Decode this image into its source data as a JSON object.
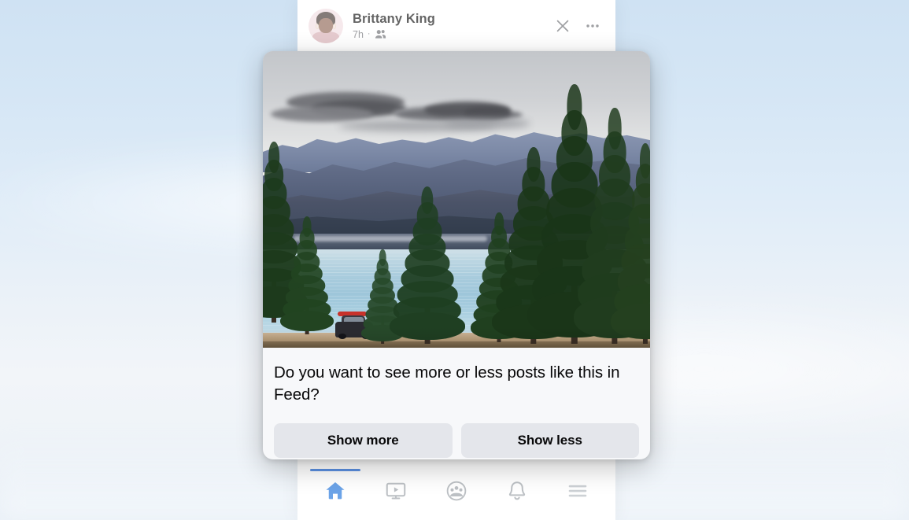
{
  "app": {
    "surface_bg": "#ffffff",
    "backdrop_desc": "blurred-photo-sky"
  },
  "post_header": {
    "avatar": "user-avatar",
    "author_name": "Brittany King",
    "timestamp": "7h",
    "separator": "·",
    "audience_icon": "friends-icon",
    "close_icon": "close-icon",
    "more_icon": "more-options-icon"
  },
  "post_photo": {
    "alt": "Mountain lake with pine trees and a car carrying a red kayak",
    "accent_kayak": "#c8322b",
    "accent_lake": "#9ec6da"
  },
  "dialog": {
    "question": "Do you want to see more or less posts like this in Feed?",
    "buttons": [
      {
        "label": "Show more",
        "name": "show-more-button"
      },
      {
        "label": "Show less",
        "name": "show-less-button"
      }
    ],
    "button_bg": "#e4e6eb",
    "card_bg": "#f7f8fa"
  },
  "bottom_nav": {
    "active_color": "#1b74e4",
    "inactive_color": "#bcc0c4",
    "items": [
      {
        "name": "nav-home",
        "icon": "home-icon",
        "active": true
      },
      {
        "name": "nav-watch",
        "icon": "video-icon",
        "active": false
      },
      {
        "name": "nav-groups",
        "icon": "groups-icon",
        "active": false
      },
      {
        "name": "nav-notifications",
        "icon": "bell-icon",
        "active": false
      },
      {
        "name": "nav-menu",
        "icon": "hamburger-menu-icon",
        "active": false
      }
    ]
  }
}
